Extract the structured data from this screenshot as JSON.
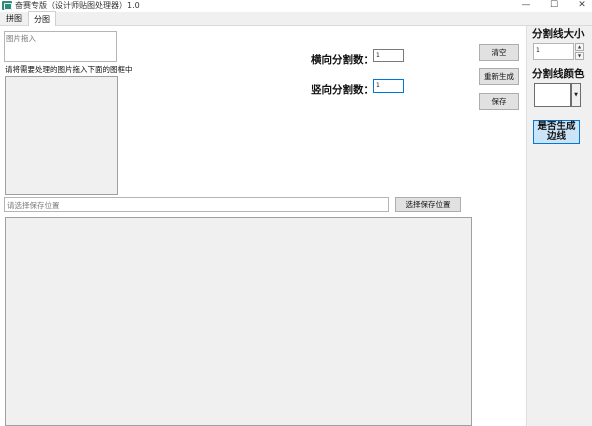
{
  "window": {
    "title": "奋赛专版（设计师贴图处理器）1.0",
    "minimize_glyph": "—",
    "maximize_glyph": "☐",
    "close_glyph": "✕"
  },
  "tabs": [
    {
      "label": "拼图"
    },
    {
      "label": "分图"
    }
  ],
  "main": {
    "image_drop_placeholder": "图片拖入",
    "drag_instruction": "请将需要处理的图片拖入下面的图框中",
    "horizontal_label": "横向分割数：",
    "horizontal_value": "1",
    "vertical_label": "竖向分割数：",
    "vertical_value": "1",
    "clear_button": "清空",
    "regenerate_button": "重新生成",
    "save_button": "保存",
    "save_path_placeholder": "请选择保存位置",
    "choose_save_location_button": "选择保存位置"
  },
  "side": {
    "line_size_label": "分割线大小",
    "line_size_value": "1",
    "spin_up_glyph": "▲",
    "spin_down_glyph": "▼",
    "line_color_label": "分割线颜色",
    "line_color_value": "#ffffff",
    "color_dropdown_glyph": "▼",
    "generate_border_button": "是否生成边线"
  },
  "colors": {
    "accent_border": "#0078d7",
    "generate_button_bg": "#cce4f7",
    "panel_bg": "#f0f0f0"
  }
}
